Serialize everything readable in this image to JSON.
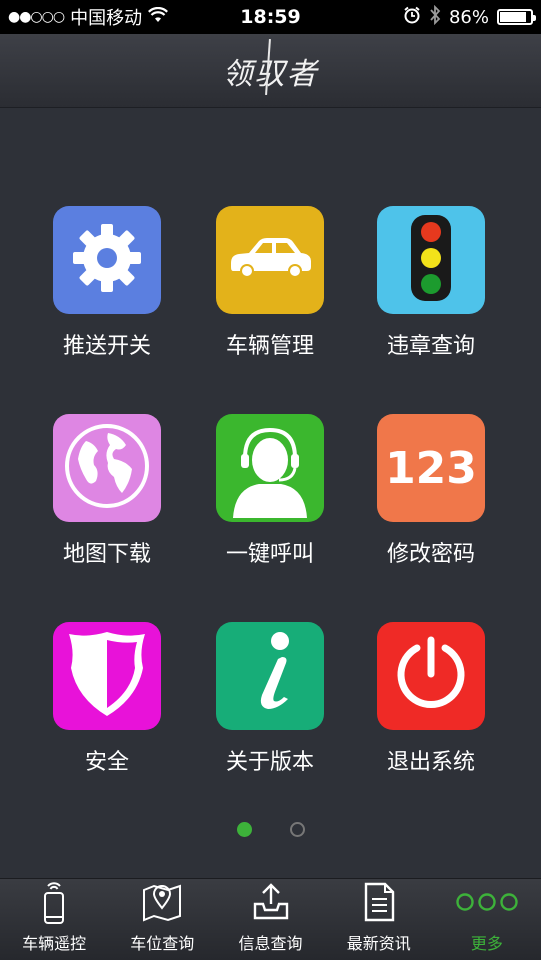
{
  "status_bar": {
    "signal": "●●○○○",
    "carrier": "中国移动",
    "time": "18:59",
    "battery_percent": "86%",
    "battery_level": 0.86
  },
  "header": {
    "logo_text": "领驭者"
  },
  "grid": [
    {
      "label": "推送开关",
      "icon": "gear-icon",
      "color": "#5b7fe0"
    },
    {
      "label": "车辆管理",
      "icon": "car-icon",
      "color": "#e3b21a"
    },
    {
      "label": "违章查询",
      "icon": "traffic-light-icon",
      "color": "#4ec3ea"
    },
    {
      "label": "地图下载",
      "icon": "globe-icon",
      "color": "#de86e3"
    },
    {
      "label": "一键呼叫",
      "icon": "headset-operator-icon",
      "color": "#3bb72e"
    },
    {
      "label": "修改密码",
      "icon": "numeric-123-icon",
      "color": "#f0774a"
    },
    {
      "label": "安全",
      "icon": "shield-icon",
      "color": "#e812d9"
    },
    {
      "label": "关于版本",
      "icon": "info-icon",
      "color": "#17ad78"
    },
    {
      "label": "退出系统",
      "icon": "power-icon",
      "color": "#ef2a26"
    }
  ],
  "pager": {
    "pages": 2,
    "current": 1,
    "active_color": "#3db23a"
  },
  "tabbar": [
    {
      "label": "车辆遥控",
      "icon": "phone-remote-icon",
      "active": false
    },
    {
      "label": "车位查询",
      "icon": "map-pin-icon",
      "active": false
    },
    {
      "label": "信息查询",
      "icon": "inbox-upload-icon",
      "active": false
    },
    {
      "label": "最新资讯",
      "icon": "document-icon",
      "active": false
    },
    {
      "label": "更多",
      "icon": "more-dots-icon",
      "active": true
    }
  ]
}
